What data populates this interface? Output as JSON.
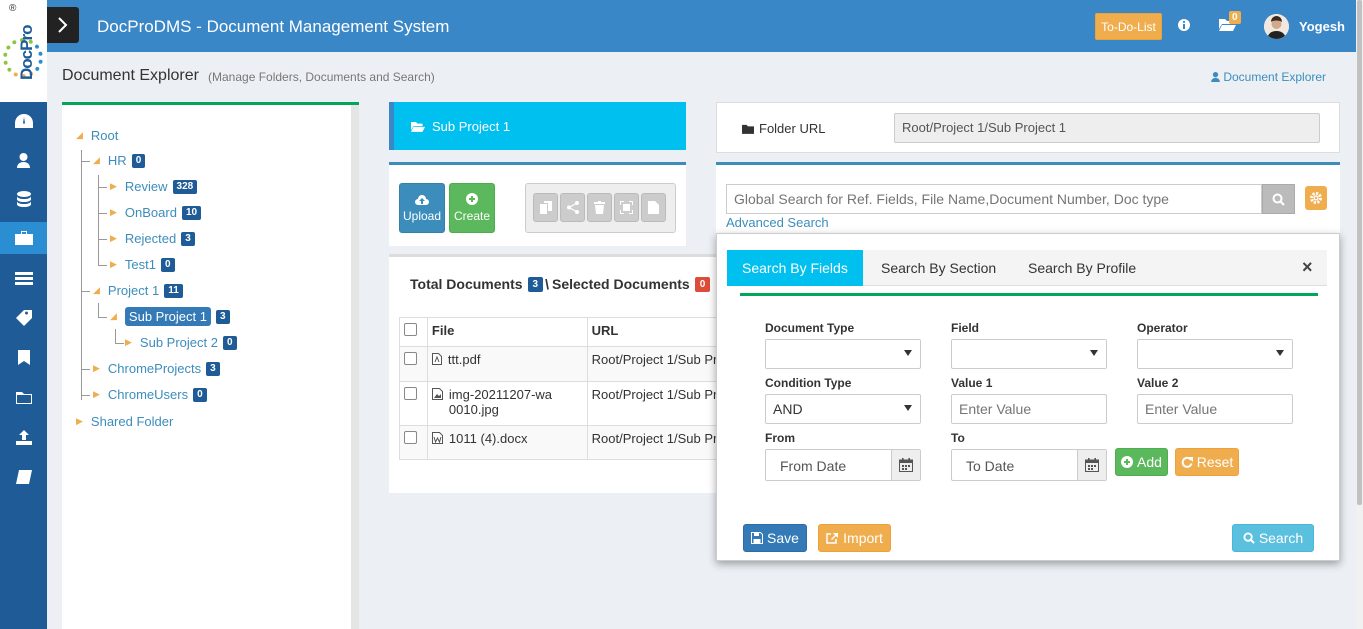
{
  "app": {
    "title": "DocProDMS - Document Management System",
    "logo_text": "DocPro",
    "logo_mark": "®"
  },
  "topbar": {
    "todo_label": "To-Do-List",
    "mail_count": "0",
    "user_name": "Yogesh"
  },
  "page": {
    "title": "Document Explorer",
    "subtitle": "(Manage Folders, Documents and Search)",
    "breadcrumb": "Document Explorer"
  },
  "rail": [
    "dashboard-icon",
    "user-icon",
    "database-icon",
    "briefcase-icon",
    "list-icon",
    "tag-icon",
    "bookmark-icon",
    "folder-icon",
    "upload-icon",
    "book-icon"
  ],
  "tree": {
    "root": "Root",
    "hr": {
      "label": "HR",
      "count": "0"
    },
    "review": {
      "label": "Review",
      "count": "328"
    },
    "onboard": {
      "label": "OnBoard",
      "count": "10"
    },
    "rejected": {
      "label": "Rejected",
      "count": "3"
    },
    "test1": {
      "label": "Test1",
      "count": "0"
    },
    "project1": {
      "label": "Project 1",
      "count": "11"
    },
    "subproject1": {
      "label": "Sub Project 1",
      "count": "3"
    },
    "subproject2": {
      "label": "Sub Project 2",
      "count": "0"
    },
    "chromeprojects": {
      "label": "ChromeProjects",
      "count": "3"
    },
    "chromeusers": {
      "label": "ChromeUsers",
      "count": "0"
    },
    "shared": "Shared Folder"
  },
  "folder": {
    "header": "Sub Project 1",
    "url_label": "Folder URL",
    "url_value": "Root/Project 1/Sub Project 1"
  },
  "toolbar": {
    "upload_label": "Upload",
    "create_label": "Create"
  },
  "documents": {
    "total_label": "Total Documents",
    "total_count": "3",
    "separator": "\\",
    "selected_label": "Selected Documents",
    "selected_count": "0",
    "columns": {
      "file": "File",
      "url": "URL"
    },
    "rows": [
      {
        "file": "ttt.pdf",
        "url": "Root/Project 1/Sub Pr"
      },
      {
        "file": "img-20211207-wa0010.jpg",
        "url": "Root/Project 1/Sub Pr"
      },
      {
        "file": "1011 (4).docx",
        "url": "Root/Project 1/Sub Pr"
      }
    ]
  },
  "search": {
    "placeholder": "Global Search for Ref. Fields, File Name,Document Number, Doc type",
    "advanced_link": "Advanced Search"
  },
  "advanced": {
    "tabs": [
      "Search By Fields",
      "Search By Section",
      "Search By Profile"
    ],
    "close": "×",
    "labels": {
      "document_type": "Document Type",
      "field": "Field",
      "operator": "Operator",
      "condition_type": "Condition Type",
      "value1": "Value 1",
      "value2": "Value 2",
      "from": "From",
      "to": "To"
    },
    "condition_value": "AND",
    "value_placeholder": "Enter Value",
    "from_placeholder": "From Date",
    "to_placeholder": "To Date",
    "add_label": "Add",
    "reset_label": "Reset",
    "save_label": "Save",
    "import_label": "Import",
    "search_label": "Search"
  },
  "colors": {
    "primary": "#3a87c8",
    "rail": "#1f5c97",
    "aqua": "#00c0ef",
    "green": "#5cb85c",
    "orange": "#f0ad4e",
    "red": "#dd4b39"
  }
}
